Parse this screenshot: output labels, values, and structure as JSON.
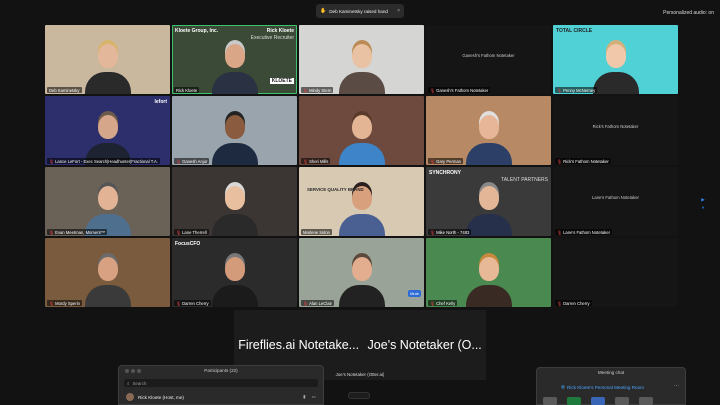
{
  "notification": {
    "icon": "raised-hand-icon",
    "text": "Deb Kaminetsky raised hand",
    "close": "×"
  },
  "audio_label": "Personalized audio: on",
  "tiles": [
    {
      "name": "Deb Kaminetsky",
      "bg": "#c9b79e",
      "skin": "#e3b89a",
      "shirt": "#2a2a2a",
      "hair": "#d8b36a",
      "muted": false
    },
    {
      "name": "Rick Kloete",
      "bg": "#3a4a36",
      "skin": "#d9a688",
      "shirt": "#2a3142",
      "hair": "#c9c9c9",
      "muted": false,
      "active": true,
      "brand_top_left": "Kloete Group, Inc.",
      "brand_top_right": "Rick Kloete",
      "brand_subtitle": "Executive Recruiter",
      "logo": "KLOETE"
    },
    {
      "name": "Mindy Stern",
      "bg": "#d5d5d3",
      "skin": "#e9c1a3",
      "shirt": "#5a4b45",
      "hair": "#bc8b55",
      "muted": true
    },
    {
      "name": "Ganesh's Fathom Notetaker",
      "bg": "#151515",
      "blank": "Ganesh's Fathom Notetaker",
      "muted": true
    },
    {
      "name": "Penny McNerney",
      "bg": "#4fd1d6",
      "skin": "#f1c8a9",
      "shirt": "#2a2a2a",
      "hair": "#d3b07a",
      "muted": true,
      "brand_top_left": "TOTAL CIRCLE"
    },
    {
      "name": "Lance LeFort - Exec Search|Headhunter|Fractional T.A.",
      "bg": "#2c2f6b",
      "skin": "#d6a68a",
      "shirt": "#1d2330",
      "hair": "#6b5a4a",
      "muted": true,
      "brand_top_right": "lefort"
    },
    {
      "name": "Ganesh Anjur",
      "bg": "#9aa4ad",
      "skin": "#8a5b3e",
      "shirt": "#1e2a40",
      "hair": "#222222",
      "muted": true
    },
    {
      "name": "Sheri Mills",
      "bg": "#6e4a3e",
      "skin": "#e3b594",
      "shirt": "#3d84c8",
      "hair": "#5a3a2a",
      "muted": true
    },
    {
      "name": "Gary Perman",
      "bg": "#b78a65",
      "skin": "#e7b699",
      "shirt": "#2c3f66",
      "hair": "#e0e0e0",
      "muted": true
    },
    {
      "name": "Rick's Fathom Notetaker",
      "bg": "#151515",
      "blank": "Rick's Fathom Notetaker",
      "muted": true
    },
    {
      "name": "Evan Meetman, Moment™",
      "bg": "#6b6257",
      "skin": "#e2b395",
      "shirt": "#4f6f8f",
      "hair": "#555555",
      "muted": true
    },
    {
      "name": "Lane Therrell",
      "bg": "#3b3633",
      "skin": "#e8c0a0",
      "shirt": "#2a2a2a",
      "hair": "#d9d9d9",
      "muted": true
    },
    {
      "name": "Marlene Sidon",
      "bg": "#d7c9b2",
      "skin": "#d8a07d",
      "shirt": "#4a5f92",
      "hair": "#2a2020",
      "muted": false,
      "overlay": "SERVICE QUALITY BRAND"
    },
    {
      "name": "Mike North - 7483",
      "bg": "#3a3a3a",
      "skin": "#e2b696",
      "shirt": "#26304a",
      "hair": "#888888",
      "muted": true,
      "brand_top_left": "SYNCHRONY",
      "brand_subtitle": "TALENT PARTNERS"
    },
    {
      "name": "Lane's Fathom Notetaker",
      "bg": "#151515",
      "blank": "Lane's Fathom Notetaker",
      "muted": true
    },
    {
      "name": "Mordy Sperin",
      "bg": "#7a5b3e",
      "skin": "#d7a182",
      "shirt": "#3a3a3a",
      "hair": "#6b6b6b",
      "muted": true
    },
    {
      "name": "Darren Cherry",
      "bg": "#2b2b2b",
      "skin": "#d49b7b",
      "shirt": "#1b1b1b",
      "hair": "#777777",
      "muted": true,
      "brand_top_left": "FocusCFO"
    },
    {
      "name": "Alan LeClair",
      "bg": "#9aa397",
      "skin": "#e3ad8f",
      "shirt": "#222222",
      "hair": "#5a4a3e",
      "muted": true,
      "badge": "Mute"
    },
    {
      "name": "Chef Kelly",
      "bg": "#4a8a50",
      "skin": "#e8b997",
      "shirt": "#3a2a24",
      "hair": "#c7893e",
      "muted": true
    },
    {
      "name": "Darren Cherry",
      "bg": "#151515",
      "blank": "",
      "muted": true
    }
  ],
  "side_control": {
    "next": "▶",
    "pause": "⏸"
  },
  "bottom_panel": {
    "left": "Fireflies.ai Notetake...",
    "right": "Joe's Notetaker (O...",
    "caption": "Joe's Notetaker (Otter.ai)"
  },
  "participants": {
    "title": "Participants (22)",
    "search_placeholder": "Search",
    "first_row": "Rick Kloete (Host, me)"
  },
  "chat": {
    "title": "Meeting chat",
    "room": "Rick Kloete's Personal Meeting Room",
    "more": "···"
  },
  "colors": {
    "accent": "#2d8cff",
    "active_border": "#3cc26b",
    "muted": "#e44444"
  }
}
